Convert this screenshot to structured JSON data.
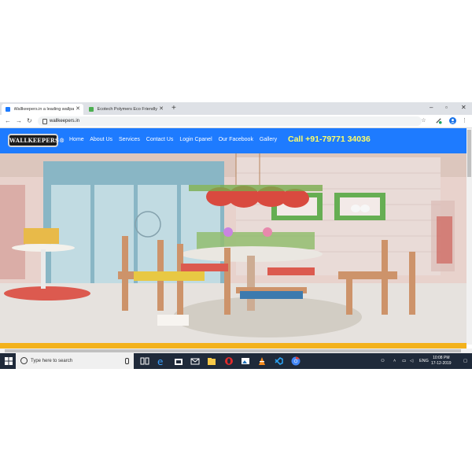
{
  "browser": {
    "tabs": [
      {
        "title": "Wallkeepers.in a leading wallpa",
        "active": true
      },
      {
        "title": "Ecotech Polymers Eco Friendly In",
        "active": false
      }
    ],
    "new_tab_label": "+",
    "url": "wallkeepers.in",
    "window_controls": [
      "–",
      "▫",
      "✕"
    ]
  },
  "site": {
    "logo_text": "WALLKEEPERS®",
    "nav": [
      "Home",
      "About Us",
      "Services",
      "Contact Us",
      "Login Cpanel",
      "Our Facebook",
      "Gallery"
    ],
    "call_text": "Call +91-79771 34036",
    "brand_color": "#1e7bff",
    "call_color": "#ffff66",
    "band_color": "#f3b21c"
  },
  "taskbar": {
    "search_placeholder": "Type here to search",
    "language": "ENG",
    "time": "10:08 PM",
    "date": "17-12-2019",
    "apps": [
      "task-view-icon",
      "edge-icon",
      "store-icon",
      "mail-icon",
      "file-explorer-icon",
      "opera-icon",
      "photos-icon",
      "vlc-icon",
      "vscode-icon",
      "chrome-icon"
    ]
  }
}
